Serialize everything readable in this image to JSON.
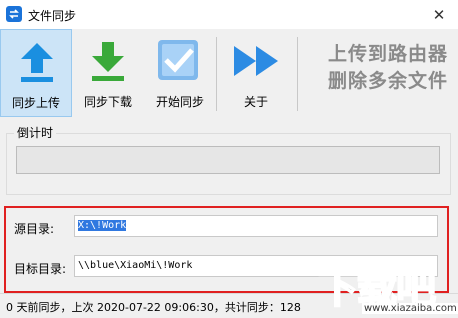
{
  "window": {
    "title": "文件同步",
    "close_glyph": "✕"
  },
  "toolbar": {
    "items": [
      {
        "label": "同步上传",
        "icon": "upload-arrow-icon",
        "active": true
      },
      {
        "label": "同步下载",
        "icon": "download-arrow-icon"
      },
      {
        "label": "开始同步",
        "icon": "checkmark-icon"
      },
      {
        "label": "关于",
        "icon": "fast-forward-icon"
      }
    ],
    "slogan_line1": "上传到路由器",
    "slogan_line2": "删除多余文件"
  },
  "countdown": {
    "label": "倒计时",
    "progress": 0
  },
  "paths": {
    "source_label": "源目录:",
    "source_value": "X:\\!Work",
    "target_label": "目标目录:",
    "target_value": "\\\\blue\\XiaoMi\\!Work"
  },
  "status": {
    "text": "0 天前同步，上次 2020-07-22 09:06:30，共计同步：128"
  },
  "watermark": {
    "text": "下载吧",
    "url": "www.xiazaiba.com"
  },
  "colors": {
    "accent_blue": "#1a8fe0",
    "accent_green": "#3aa93a",
    "highlight_red": "#e02020",
    "selection": "#3078e0"
  }
}
